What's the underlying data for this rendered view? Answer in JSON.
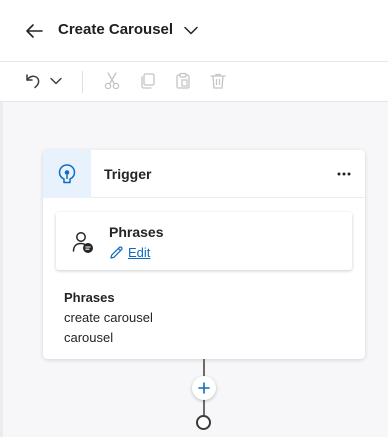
{
  "header": {
    "title": "Create Carousel",
    "back_icon": "arrow-left-icon",
    "title_menu_icon": "chevron-down-icon"
  },
  "toolbar": {
    "items": [
      {
        "icon": "undo-icon",
        "enabled": true
      },
      {
        "icon": "chevron-down-icon",
        "enabled": true
      },
      {
        "icon": "cut-icon",
        "enabled": false
      },
      {
        "icon": "copy-icon",
        "enabled": false
      },
      {
        "icon": "paste-icon",
        "enabled": false
      },
      {
        "icon": "delete-icon",
        "enabled": false
      }
    ]
  },
  "trigger_card": {
    "title": "Trigger",
    "icon": "trigger-icon",
    "more_icon": "more-horizontal-icon",
    "phrases_box": {
      "title": "Phrases",
      "icon": "person-chat-icon",
      "edit_label": "Edit",
      "edit_icon": "pencil-icon"
    },
    "summary": {
      "title": "Phrases",
      "items": [
        "create carousel",
        "carousel"
      ]
    }
  },
  "flow": {
    "add_icon": "plus-icon",
    "end_icon": "end-circle-icon"
  },
  "colors": {
    "accent": "#0f6cbd",
    "trigger_tint": "#e8f2fc",
    "canvas": "#f7f7f9",
    "disabled": "#c4c4c4"
  }
}
